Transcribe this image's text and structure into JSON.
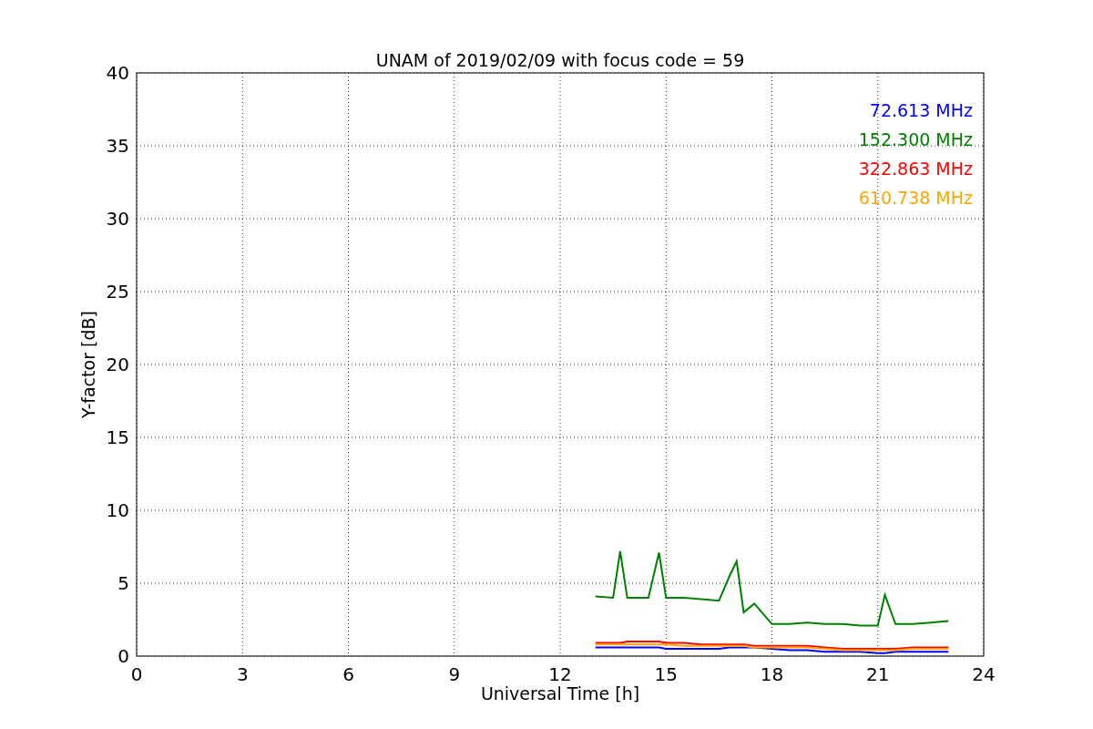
{
  "chart": {
    "chart_data": {
      "type": "line",
      "title": "UNAM of 2019/02/09 with focus code = 59",
      "xlabel": "Universal Time [h]",
      "ylabel": "Y-factor [dB]",
      "x": [
        13,
        13.5,
        13.7,
        13.9,
        14.5,
        14.8,
        15,
        15.5,
        16,
        16.5,
        16.8,
        17,
        17.2,
        17.5,
        18,
        18.5,
        19,
        19.5,
        20,
        20.5,
        21,
        21.2,
        21.5,
        22,
        22.5,
        23
      ],
      "series": [
        {
          "name": "72.613 MHz",
          "color": "#0000ff",
          "values": [
            0.6,
            0.6,
            0.6,
            0.6,
            0.6,
            0.6,
            0.5,
            0.5,
            0.5,
            0.5,
            0.6,
            0.6,
            0.6,
            0.6,
            0.5,
            0.4,
            0.4,
            0.3,
            0.3,
            0.3,
            0.2,
            0.2,
            0.3,
            0.3,
            0.3,
            0.3
          ]
        },
        {
          "name": "152.300 MHz",
          "color": "#008000",
          "values": [
            4.1,
            4.0,
            7.2,
            4.0,
            4.0,
            7.1,
            4.0,
            4.0,
            3.9,
            3.8,
            5.5,
            6.5,
            3.0,
            3.6,
            2.2,
            2.2,
            2.3,
            2.2,
            2.2,
            2.1,
            2.1,
            4.2,
            2.2,
            2.2,
            2.3,
            2.4
          ]
        },
        {
          "name": "322.863 MHz",
          "color": "#ff0000",
          "values": [
            0.9,
            0.9,
            0.9,
            1.0,
            1.0,
            1.0,
            0.9,
            0.9,
            0.8,
            0.8,
            0.8,
            0.8,
            0.8,
            0.7,
            0.7,
            0.7,
            0.7,
            0.6,
            0.5,
            0.5,
            0.5,
            0.5,
            0.5,
            0.6,
            0.6,
            0.6
          ]
        },
        {
          "name": "610.738 MHz",
          "color": "#ffa500",
          "values": [
            0.8,
            0.8,
            0.8,
            0.8,
            0.8,
            0.8,
            0.8,
            0.7,
            0.7,
            0.7,
            0.7,
            0.7,
            0.7,
            0.6,
            0.6,
            0.6,
            0.6,
            0.5,
            0.4,
            0.4,
            0.4,
            0.4,
            0.4,
            0.5,
            0.5,
            0.5
          ]
        }
      ],
      "grid": true,
      "xlim": [
        0,
        24
      ],
      "ylim": [
        0,
        40
      ],
      "xticks": [
        0,
        3,
        6,
        9,
        12,
        15,
        18,
        21,
        24
      ],
      "yticks": [
        0,
        5,
        10,
        15,
        20,
        25,
        30,
        35,
        40
      ]
    }
  }
}
